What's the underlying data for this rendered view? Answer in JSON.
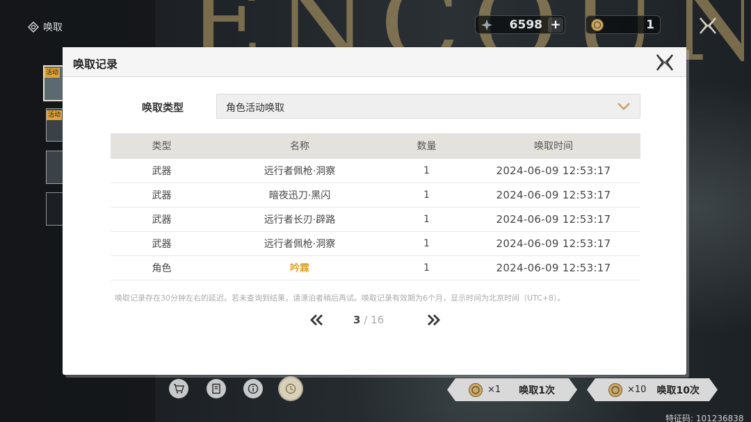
{
  "header": {
    "title": "唤取"
  },
  "background": {
    "deco_text": "ENCOUNTER"
  },
  "currency": [
    {
      "icon": "lustrous-tide-icon",
      "value": "6598",
      "plus": "+"
    },
    {
      "icon": "radiant-tide-coin-icon",
      "value": "1"
    }
  ],
  "side_banners": [
    {
      "tag": "活动"
    },
    {
      "tag": "活动"
    },
    {
      "tag": ""
    },
    {
      "tag": ""
    }
  ],
  "modal": {
    "title": "唤取记录",
    "type_label": "唤取类型",
    "type_value": "角色活动唤取",
    "columns": [
      "类型",
      "名称",
      "数量",
      "唤取时间"
    ],
    "rows": [
      {
        "type": "武器",
        "name": "远行者佩枪·洞察",
        "qty": "1",
        "time": "2024-06-09 12:53:17"
      },
      {
        "type": "武器",
        "name": "暗夜迅刀·黑闪",
        "qty": "1",
        "time": "2024-06-09 12:53:17"
      },
      {
        "type": "武器",
        "name": "远行者长刃·辟路",
        "qty": "1",
        "time": "2024-06-09 12:53:17"
      },
      {
        "type": "武器",
        "name": "远行者佩枪·洞察",
        "qty": "1",
        "time": "2024-06-09 12:53:17"
      },
      {
        "type": "角色",
        "name": "吟霖",
        "qty": "1",
        "time": "2024-06-09 12:53:17",
        "highlight": true
      }
    ],
    "notice": "唤取记录存在30分钟左右的延迟。若未查询到结果，请漂泊者稍后再试。唤取记录有效期为6个月，显示时间为北京时间（UTC+8）。",
    "pager": {
      "current": "3",
      "separator": "/",
      "total": "16"
    }
  },
  "pulls": [
    {
      "mult": "×1",
      "label": "唤取1次"
    },
    {
      "mult": "×10",
      "label": "唤取10次"
    }
  ],
  "feature_code": "特征码: 101236838",
  "colors": {
    "highlight": "#e0a32a",
    "header_bg": "#e4e2dd",
    "accent_gold": "#c4aa6e"
  }
}
